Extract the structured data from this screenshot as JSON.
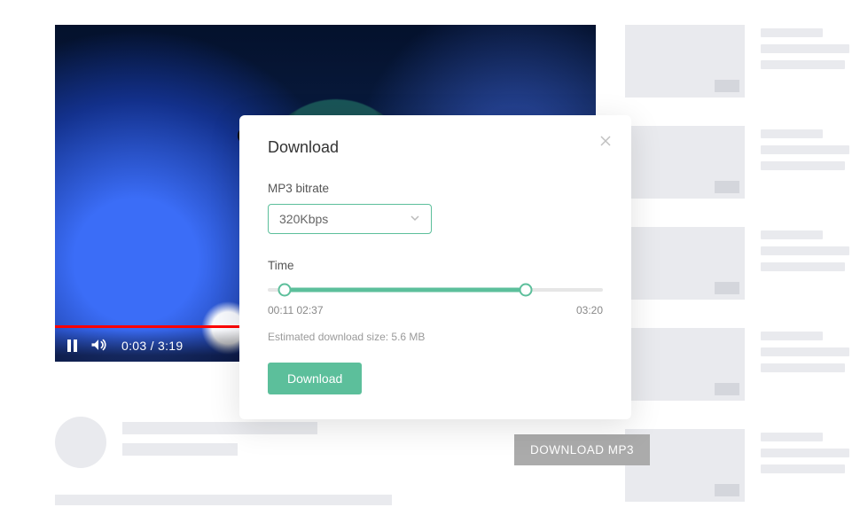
{
  "video": {
    "current_time": "0:03",
    "total_time": "3:19"
  },
  "modal": {
    "title": "Download",
    "bitrate_label": "MP3 bitrate",
    "bitrate_value": "320Kbps",
    "time_label": "Time",
    "time_left": "00:11 02:37",
    "time_right": "03:20",
    "estimated_prefix": "Estimated download size: ",
    "estimated_size": "5.6 MB",
    "download_button": "Download"
  },
  "download_mp3_button": "DOWNLOAD MP3",
  "colors": {
    "accent": "#5cbf9b",
    "red": "#ff0000",
    "skeleton": "#e9eaee"
  }
}
